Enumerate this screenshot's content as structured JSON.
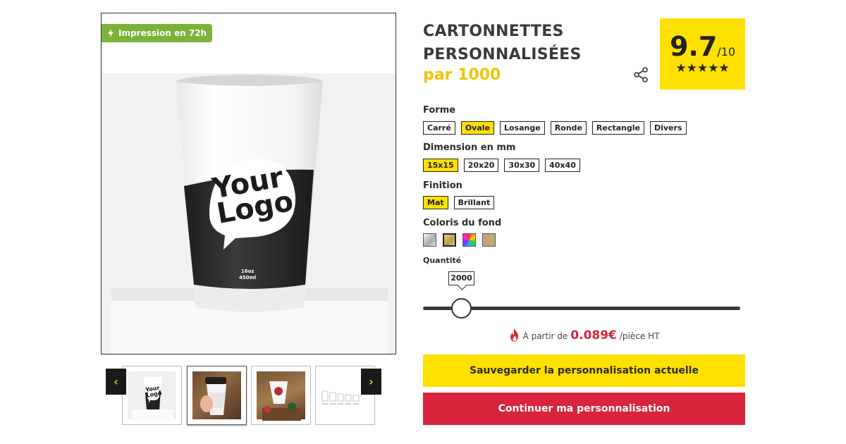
{
  "badge": {
    "label": "Impression en 72h",
    "icon": "lightning-icon"
  },
  "cup": {
    "logo_line1": "Your",
    "logo_line2": "Logo",
    "size_line1": "16oz",
    "size_line2": "450ml"
  },
  "product": {
    "title_line1": "CARTONNETTES",
    "title_line2": "PERSONNALISÉES",
    "subtitle": "par 1000"
  },
  "rating": {
    "score": "9.7",
    "scale": "/10",
    "stars": "★★★★★",
    "value": 9.7,
    "max": 10
  },
  "forme": {
    "label": "Forme",
    "options": [
      "Carré",
      "Ovale",
      "Losange",
      "Ronde",
      "Rectangle",
      "Divers"
    ],
    "selected": "Ovale"
  },
  "dimension": {
    "label": "Dimension en mm",
    "options": [
      "15x15",
      "20x20",
      "30x30",
      "40x40"
    ],
    "selected": "15x15"
  },
  "finition": {
    "label": "Finition",
    "options": [
      "Mat",
      "Brillant"
    ],
    "selected": "Mat"
  },
  "coloris": {
    "label": "Coloris du fond",
    "swatches": [
      {
        "name": "silver",
        "color": "#c8c8c8"
      },
      {
        "name": "gold",
        "color": "#c8b06a"
      },
      {
        "name": "multicolor",
        "color": "#e040a0"
      },
      {
        "name": "kraft",
        "color": "#c4a57a"
      }
    ],
    "selected": "gold"
  },
  "quantite": {
    "label": "Quantité",
    "value": "2000"
  },
  "price": {
    "prefix": "À partir de",
    "value": "0.089€",
    "suffix": "/pièce HT"
  },
  "actions": {
    "save_label": "Sauvegarder la personnalisation actuelle",
    "continue_label": "Continuer ma personnalisation"
  },
  "thumbnails": {
    "prev": "‹",
    "next": "›",
    "items": [
      {
        "logo_line1": "Your",
        "logo_line2": "Logo"
      },
      {
        "label": ""
      },
      {
        "label": ""
      },
      {
        "label": ""
      }
    ]
  },
  "colors": {
    "accent_yellow": "#ffe100",
    "accent_red": "#d8253b",
    "badge_green": "#7bb33a"
  }
}
